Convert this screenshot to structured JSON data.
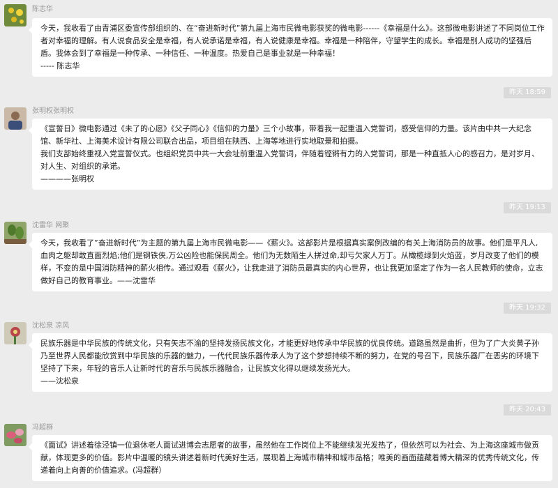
{
  "messages": [
    {
      "sender": "陈志华",
      "paragraphs": [
        "今天，我收看了由青浦区委宣传部组织的、在“奋进新时代”第九届上海市民微电影获奖的微电影------《幸福是什么》。这部微电影讲述了不同岗位工作者对幸福的理解。有人说食品安全是幸福，有人说承诺是幸福，有人说健康是幸福。幸福是一种陪伴，守望学生的成长。幸福是别人成功的坚强后盾。我体会到了幸福是一种传承、一种信任、一种温度。热爱自己是事业就是一种幸福！",
        "----- 陈志华"
      ],
      "time": "昨天 18:59"
    },
    {
      "sender": "张明权张明权",
      "paragraphs": [
        "《宣誓日》微电影通过《未了的心愿》《父子同心》《信仰的力量》三个小故事，带着我一起重温入党誓词，感受信仰的力量。该片由中共一大纪念馆、新华社、上海美术设计有限公司联合出品，项目组在陕西、上海等地进行实地取景和拍摄。",
        "我们支部始终重视入党宣誓仪式。也组织党员中共一大会址前重温入党誓词，伴随着铿锵有力的入党誓词，那是一种直抵人心的感召力，是对岁月、对人生、对组织的承诺。",
        "————张明权"
      ],
      "time": "昨天 19:13"
    },
    {
      "sender": "沈雷华 网聚",
      "paragraphs": [
        "今天，我收看了”奋进新时代”为主题的第九届上海市民微电影——《薪火》。这部影片是根据真实案例改编的有关上海消防员的故事。他们是平凡人,血肉之躯却敢直面烈焰;他们是钢铁侠,万公凶险也能保民周全。他们为无数陌生人拼过命,却亏欠家人万丁。从橄榄绿到火焰蓝，岁月改变了他们的模样，不变的是中国消防精神的薪火相传。通过观看《薪火》，让我走进了消防员最真实的内心世界，也让我更加坚定了作为一名人民教师的使命，立志做好自己的教育事业。——沈雷华"
      ],
      "time": "昨天 19:32"
    },
    {
      "sender": "沈松泉 凉风",
      "paragraphs": [
        "民族乐器是中华民族的传统文化，只有矢志不渝的坚持发扬民族文化，才能更好地传承中华民族的优良传统。道路虽然是曲折，但为了广大炎黄子孙乃至世界人民都能欣赏到中华民族的乐器的魅力，一代代民族乐器传承人为了这个梦想持续不断的努力，在党的号召下，民族乐器厂在恶劣的环境下坚持了下来，年轻的音乐人让新时代的音乐与民族乐器融合，让民族文化得以继续发扬光大。",
        "——沈松泉"
      ],
      "time": "昨天 20:43"
    },
    {
      "sender": "冯超群",
      "paragraphs": [
        "《面试》讲述着徐泾镇一位退休老人面试进博会志愿者的故事，虽然他在工作岗位上不能继续发光发热了，但依然可以为社会、为上海这座城市做贡献，体现更多的价值。影片中温暖的镜头讲述着新时代美好生活，展现着上海城市精神和城市品格；唯美的画面蕴藏着博大精深的优秀传统文化，传递着向上向善的价值追求。(冯超群）"
      ]
    }
  ]
}
